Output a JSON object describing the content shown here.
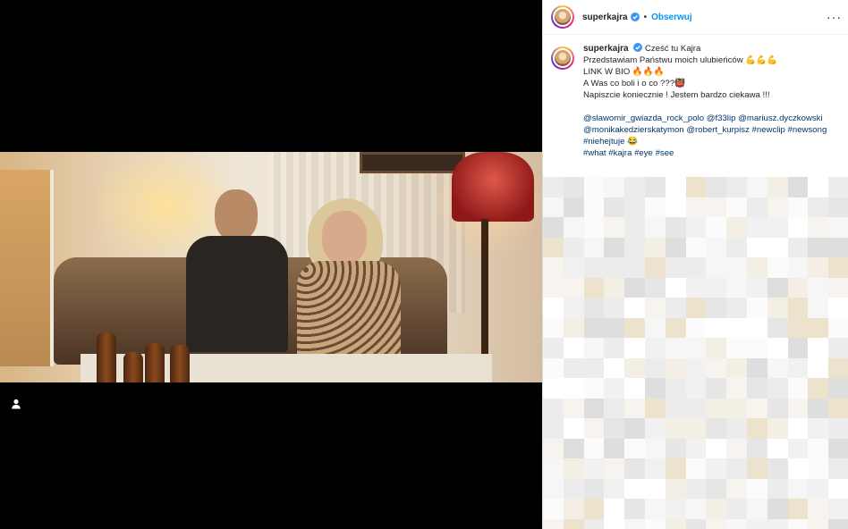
{
  "post": {
    "username": "superkajra",
    "follow_label": "Obserwuj",
    "separator": "•",
    "more_label": "···"
  },
  "caption": {
    "username": "superkajra",
    "lines": [
      "Cześć tu Kajra",
      "Przedstawiam Państwu moich ulubieńców 💪💪💪",
      "LINK W BIO 🔥🔥🔥",
      "A Was co boli i o co ???👹",
      "Napiszcie koniecznie ! Jestem bardzo ciekawa !!!"
    ],
    "tags": [
      "@slawomir_gwiazda_rock_polo",
      "@f33lip",
      "@mariusz.dyczkowski",
      "@monikakedzierskatymon",
      "@robert_kurpisz",
      "#newclip",
      "#newsong",
      "#niehejtuje",
      "#what",
      "#kajra",
      "#eye",
      "#see"
    ],
    "emoji_after_niehejtuje": "😂"
  },
  "colors": {
    "follow": "#0095f6",
    "tag": "#00376b",
    "verified": "#3897f0"
  }
}
